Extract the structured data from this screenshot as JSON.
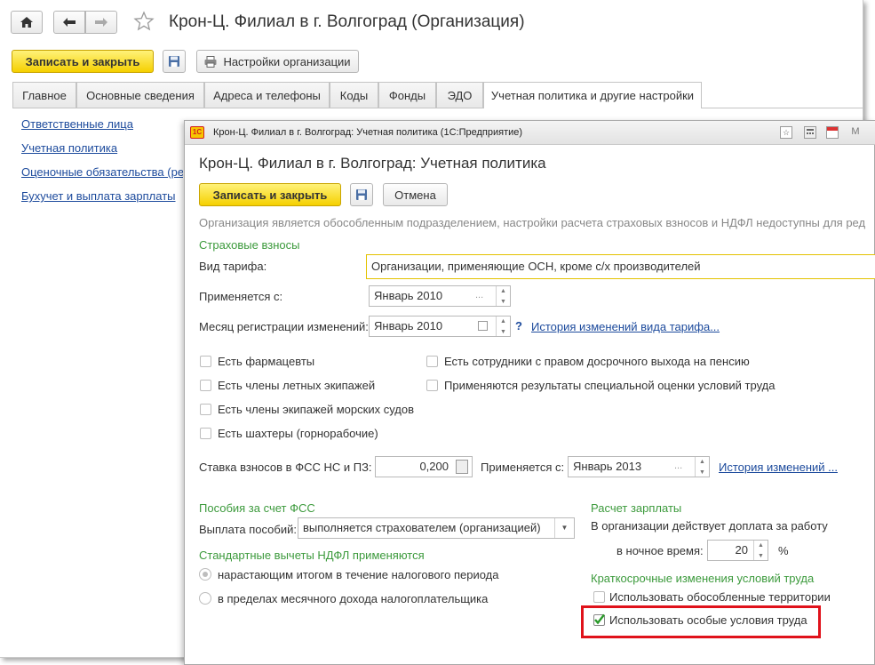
{
  "outer": {
    "title": "Крон-Ц. Филиал в г. Волгоград (Организация)",
    "save_close_label": "Записать и закрыть",
    "settings_label": "Настройки организации",
    "tabs": [
      {
        "label": "Главное"
      },
      {
        "label": "Основные сведения"
      },
      {
        "label": "Адреса и телефоны"
      },
      {
        "label": "Коды"
      },
      {
        "label": "Фонды"
      },
      {
        "label": "ЭДО"
      },
      {
        "label": "Учетная политика и другие настройки"
      }
    ],
    "active_tab": "Учетная политика и другие настройки",
    "sidebar_links": [
      "Ответственные лица",
      "Учетная политика",
      "Оценочные обязательства (ре",
      "Бухучет и выплата зарплаты"
    ]
  },
  "inner": {
    "window_title": "Крон-Ц. Филиал в г. Волгоград: Учетная политика  (1С:Предприятие)",
    "title_icons": [
      "star-icon",
      "calculator-icon",
      "calendar-icon",
      "m-icon"
    ],
    "header": "Крон-Ц. Филиал в г. Волгоград: Учетная политика",
    "save_close_label": "Записать и закрыть",
    "cancel_label": "Отмена",
    "info_text": "Организация является обособленным подразделением, настройки расчета страховых взносов и НДФЛ недоступны для ред",
    "insurance": {
      "section_title": "Страховые взносы",
      "tariff_label": "Вид тарифа:",
      "tariff_value": "Организации, применяющие ОСН, кроме с/х производителей",
      "applies_label": "Применяется с:",
      "applies_value": "Январь 2010",
      "reg_month_label": "Месяц регистрации изменений:",
      "reg_month_value": "Январь 2010",
      "help_mark": "?",
      "history_link": "История изменений вида тарифа...",
      "checkboxes_left": [
        {
          "label": "Есть фармацевты",
          "checked": false
        },
        {
          "label": "Есть члены летных экипажей",
          "checked": false
        },
        {
          "label": "Есть члены экипажей морских судов",
          "checked": false
        },
        {
          "label": "Есть шахтеры (горнорабочие)",
          "checked": false
        }
      ],
      "checkboxes_right": [
        {
          "label": "Есть сотрудники с правом досрочного выхода на пенсию",
          "checked": false
        },
        {
          "label": "Применяются результаты специальной оценки условий труда",
          "checked": false
        }
      ],
      "fss_rate_label": "Ставка взносов в ФСС НС и ПЗ:",
      "fss_rate_value": "0,200",
      "fss_applies_label": "Применяется с:",
      "fss_applies_value": "Январь 2013",
      "fss_history_link": "История изменений ..."
    },
    "benefits": {
      "section_title": "Пособия за счет ФСС",
      "payment_label": "Выплата пособий:",
      "payment_value": "выполняется страхователем (организацией)"
    },
    "ndfl": {
      "section_title": "Стандартные вычеты НДФЛ применяются",
      "options": [
        {
          "label": "нарастающим итогом в течение налогового периода",
          "selected": true
        },
        {
          "label": "в пределах месячного дохода налогоплательщика",
          "selected": false
        }
      ]
    },
    "salary": {
      "section_title": "Расчет зарплаты",
      "bonus_text": "В организации действует доплата за работу",
      "night_label": "в ночное время:",
      "night_value": "20",
      "percent": "%"
    },
    "short_term": {
      "section_title": "Краткосрочные изменения условий труда",
      "separate_territories": {
        "label": "Использовать обособленные территории",
        "checked": false
      },
      "special_conditions": {
        "label": "Использовать особые условия труда",
        "checked": true
      }
    }
  },
  "colors": {
    "accent_yellow": "#f5d000",
    "section_green": "#3c9a3c",
    "link_blue": "#1c4a9c",
    "highlight_red": "#e0121b"
  }
}
